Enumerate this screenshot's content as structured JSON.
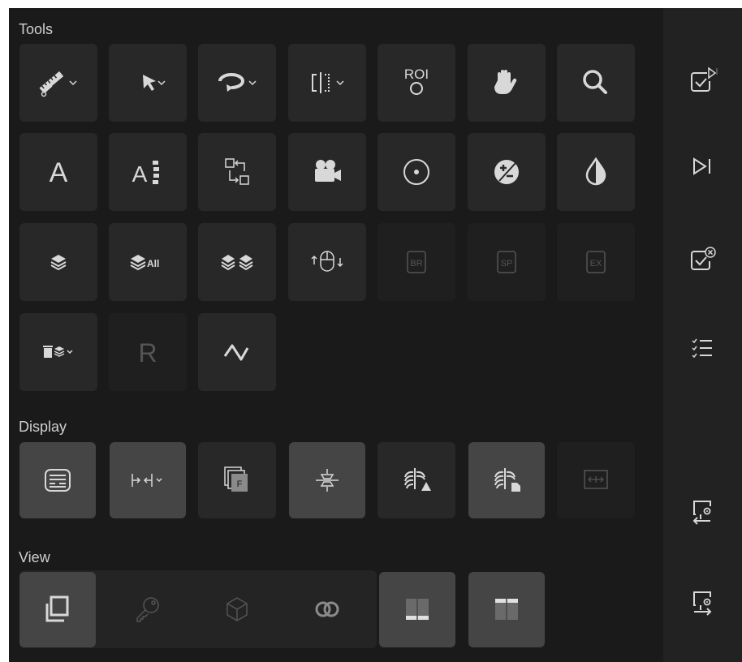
{
  "sections": {
    "tools": "Tools",
    "display": "Display",
    "view": "View"
  },
  "tools": [
    {
      "name": "ruler-measure",
      "icon": "ruler-icon",
      "dropdown": true
    },
    {
      "name": "select-pointer",
      "icon": "arrow-pointer-icon",
      "dropdown": true
    },
    {
      "name": "rotate",
      "icon": "rotate-icon",
      "dropdown": true
    },
    {
      "name": "flip",
      "icon": "flip-icon",
      "dropdown": true
    },
    {
      "name": "roi",
      "icon": "roi-icon",
      "label": "ROI"
    },
    {
      "name": "pan",
      "icon": "hand-icon"
    },
    {
      "name": "zoom",
      "icon": "magnifier-icon"
    },
    {
      "name": "text-annotation",
      "icon": "letter-a-icon",
      "label": "A"
    },
    {
      "name": "spine-label",
      "icon": "spine-label-icon",
      "label": "A"
    },
    {
      "name": "link",
      "icon": "sync-link-icon"
    },
    {
      "name": "cine",
      "icon": "movie-camera-icon"
    },
    {
      "name": "point",
      "icon": "target-icon"
    },
    {
      "name": "brightness",
      "icon": "plus-minus-icon"
    },
    {
      "name": "contrast",
      "icon": "contrast-drop-icon"
    },
    {
      "name": "layer",
      "icon": "layers-icon"
    },
    {
      "name": "layer-all",
      "icon": "layers-all-icon",
      "label": "All"
    },
    {
      "name": "layers-double",
      "icon": "layers-double-icon"
    },
    {
      "name": "scroll",
      "icon": "mouse-scroll-icon"
    },
    {
      "name": "br-marker",
      "icon": "br-icon",
      "label": "BR"
    },
    {
      "name": "sp-marker",
      "icon": "sp-icon",
      "label": "SP"
    },
    {
      "name": "ex-marker",
      "icon": "ex-icon",
      "label": "EX"
    },
    {
      "name": "delete-layer",
      "icon": "trash-layers-icon",
      "dropdown": true
    },
    {
      "name": "reset",
      "icon": "letter-r-icon",
      "label": "R"
    },
    {
      "name": "polyline",
      "icon": "polyline-icon"
    }
  ],
  "display": [
    {
      "name": "overlay-info",
      "icon": "overlay-info-icon"
    },
    {
      "name": "fit-width",
      "icon": "fit-arrows-icon",
      "dropdown": true
    },
    {
      "name": "frames",
      "icon": "frames-icon",
      "label": "F"
    },
    {
      "name": "flip-vertical",
      "icon": "flip-vertical-icon"
    },
    {
      "name": "chest-marker",
      "icon": "chest-triangle-icon"
    },
    {
      "name": "chest-report",
      "icon": "chest-document-icon"
    },
    {
      "name": "expand-horizontal",
      "icon": "expand-horizontal-icon"
    }
  ],
  "view": [
    {
      "name": "single-view",
      "icon": "stacked-squares-icon"
    },
    {
      "name": "key-view",
      "icon": "key-icon"
    },
    {
      "name": "3d-view",
      "icon": "cube-icon"
    },
    {
      "name": "fusion-view",
      "icon": "overlap-circles-icon"
    },
    {
      "name": "layout-horizontal",
      "icon": "layout-split-bottom-icon"
    },
    {
      "name": "layout-vertical",
      "icon": "layout-split-top-icon"
    }
  ],
  "rail": [
    {
      "name": "approve",
      "icon": "check-play-icon"
    },
    {
      "name": "next",
      "icon": "skip-next-icon"
    },
    {
      "name": "reject",
      "icon": "check-cancel-icon"
    },
    {
      "name": "worklist",
      "icon": "checklist-icon"
    },
    {
      "name": "import-settings",
      "icon": "monitor-import-icon"
    },
    {
      "name": "export-settings",
      "icon": "monitor-export-icon"
    }
  ],
  "colors": {
    "panel": "#1a1a1a",
    "button": "#282828",
    "button-light": "#454545",
    "icon": "#d8d8d8",
    "icon-dim": "#555555"
  }
}
